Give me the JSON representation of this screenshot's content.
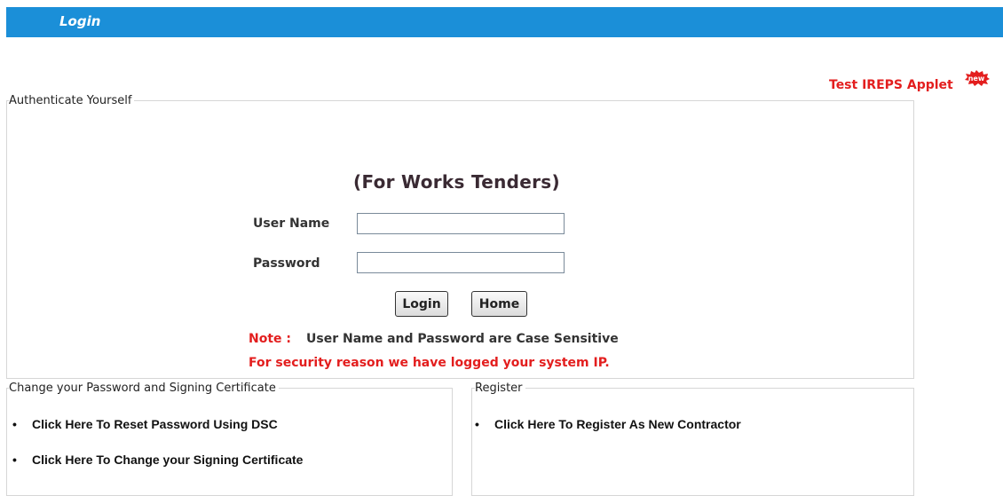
{
  "header": {
    "title": "Login"
  },
  "test_applet": {
    "label": "Test IREPS Applet",
    "badge": "new"
  },
  "auth": {
    "legend": "Authenticate Yourself",
    "subtitle": "(For Works Tenders)",
    "username_label": "User Name",
    "username_value": "",
    "password_label": "Password",
    "password_value": "",
    "login_button": "Login",
    "home_button": "Home",
    "note_prefix": "Note :",
    "note_text": "User Name and Password are Case Sensitive",
    "security_text": "For security reason we have logged your system IP."
  },
  "change": {
    "legend": "Change your Password and Signing Certificate",
    "items": [
      {
        "label": "Click Here To Reset Password Using DSC"
      },
      {
        "label": "Click Here To Change your Signing Certificate"
      }
    ]
  },
  "register": {
    "legend": "Register",
    "items": [
      {
        "label": "Click Here To Register As New Contractor"
      }
    ]
  },
  "bullet": "•"
}
